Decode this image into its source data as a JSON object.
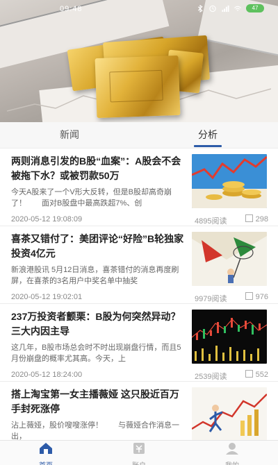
{
  "status_bar": {
    "time": "09:48",
    "battery": "47"
  },
  "tabs": [
    {
      "label": "新闻",
      "active": false
    },
    {
      "label": "分析",
      "active": true
    }
  ],
  "articles": [
    {
      "title": "两则消息引发的B股“血案”：A股会不会被拖下水？或被罚款50万",
      "summary": "今天A股来了一个V形大反转，但是B股却高奇崩了！　　面对B股盘中最高跌超7%、创",
      "date": "2020-05-12 19:08:09",
      "reads": "4895阅读",
      "shares": "298",
      "thumb_icon": "gold-coins-chart-thumbnail"
    },
    {
      "title": "喜茶又错付了：美团评论“好险”B轮独家投资4亿元",
      "summary": "新浪港股讯 5月12日消息，喜茶错付的消息再度刷屏，在喜茶的3名用户中奖名单中抽奖",
      "date": "2020-05-12 19:02:01",
      "reads": "9979阅读",
      "shares": "976",
      "thumb_icon": "cartoon-net-thumbnail"
    },
    {
      "title": "237万投资者颤栗：B股为何突然异动？三大内因主导",
      "summary": "这几年，B股市场总会时不时出现崩盘行情，而且5月份崩盘的概率尤其高。今天，上",
      "date": "2020-05-12 18:24:00",
      "reads": "2539阅读",
      "shares": "552",
      "thumb_icon": "candlestick-chart-thumbnail"
    },
    {
      "title": "搭上淘宝第一女主播薇娅 这只股近百万手封死涨停",
      "summary": "沾上薇娅，股价嗖嗖涨停！　　与薇娅合作消息一出，",
      "date": "",
      "reads": "",
      "shares": "",
      "thumb_icon": "running-man-chart-thumbnail"
    }
  ],
  "bottom_nav": [
    {
      "label": "首页",
      "icon": "home-icon",
      "active": true
    },
    {
      "label": "账户",
      "icon": "account-icon",
      "active": false
    },
    {
      "label": "我的",
      "icon": "profile-icon",
      "active": false
    }
  ],
  "colors": {
    "accent": "#2d5ba8",
    "gold": "#d7a529"
  }
}
